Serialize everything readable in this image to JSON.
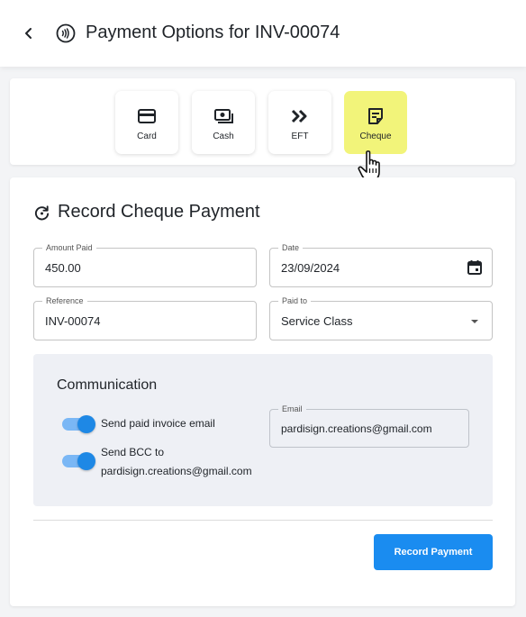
{
  "header": {
    "title": "Payment Options for INV-00074",
    "back_icon": "chevron-left-icon",
    "title_icon": "contactless-payment-icon"
  },
  "payment_methods": [
    {
      "label": "Card",
      "icon": "credit-card-icon",
      "active": false
    },
    {
      "label": "Cash",
      "icon": "cash-icon",
      "active": false
    },
    {
      "label": "EFT",
      "icon": "double-chevron-right-icon",
      "active": false
    },
    {
      "label": "Cheque",
      "icon": "cheque-note-icon",
      "active": true
    }
  ],
  "form": {
    "title": "Record Cheque Payment",
    "title_icon": "refresh-icon",
    "amount": {
      "label": "Amount Paid",
      "value": "450.00"
    },
    "date": {
      "label": "Date",
      "value": "23/09/2024",
      "icon": "calendar-icon"
    },
    "reference": {
      "label": "Reference",
      "value": "INV-00074"
    },
    "paid_to": {
      "label": "Paid to",
      "value": "Service Class",
      "icon": "dropdown-arrow-icon"
    }
  },
  "communication": {
    "title": "Communication",
    "send_paid_invoice": {
      "label": "Send paid invoice email",
      "on": true
    },
    "send_bcc": {
      "label_line1": "Send BCC to",
      "label_line2": "pardisign.creations@gmail.com",
      "on": true
    },
    "email": {
      "label": "Email",
      "value": "pardisign.creations@gmail.com"
    }
  },
  "actions": {
    "record_payment": "Record Payment"
  },
  "colors": {
    "accent": "#1a8cf0",
    "active_method": "#f2f47a",
    "toggle_track": "#7ab7f5",
    "toggle_knob": "#1e88e5",
    "panel_bg": "#eef0f5"
  }
}
